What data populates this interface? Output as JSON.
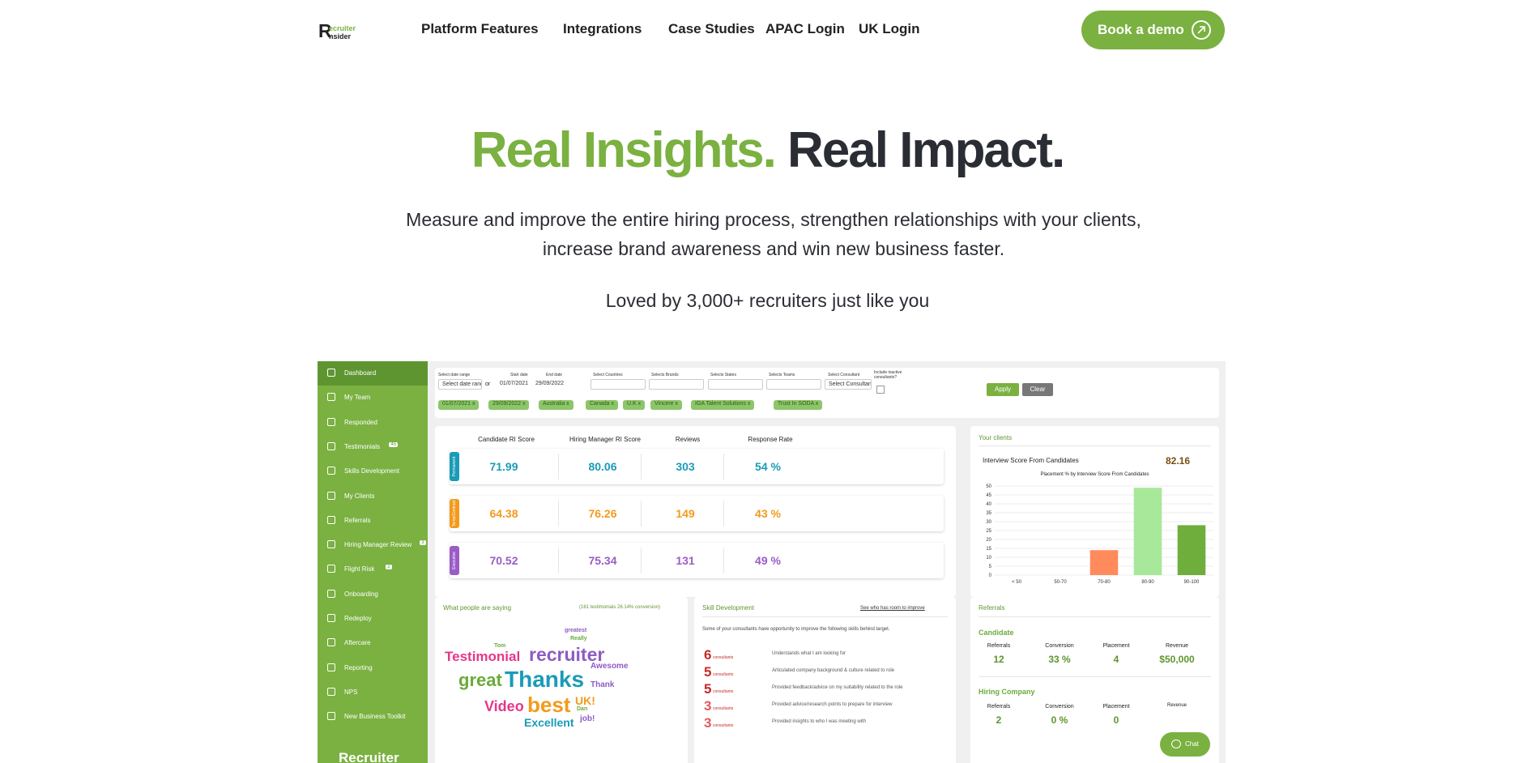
{
  "nav": {
    "logo_top": "ecruiter",
    "logo_bottom": "nsider",
    "links": [
      "Platform Features",
      "Integrations",
      "Case Studies",
      "APAC Login",
      "UK Login"
    ],
    "demo_label": "Book a demo"
  },
  "hero": {
    "title_green": "Real Insights.",
    "title_dark": " Real Impact.",
    "subtitle": "Measure and improve the entire hiring process, strengthen relationships with your clients, increase brand awareness and win new business faster.",
    "loved": "Loved by 3,000+ recruiters just like you"
  },
  "dashboard": {
    "sidebar": [
      {
        "label": "Dashboard",
        "badge": ""
      },
      {
        "label": "My Team",
        "badge": ""
      },
      {
        "label": "Responded",
        "badge": ""
      },
      {
        "label": "Testimonials",
        "badge": "45"
      },
      {
        "label": "Skills Development",
        "badge": ""
      },
      {
        "label": "My Clients",
        "badge": ""
      },
      {
        "label": "Referrals",
        "badge": ""
      },
      {
        "label": "Hiring Manager Review",
        "badge": "3"
      },
      {
        "label": "Flight Risk",
        "badge": "2"
      },
      {
        "label": "Onboarding",
        "badge": ""
      },
      {
        "label": "Redeploy",
        "badge": ""
      },
      {
        "label": "Aftercare",
        "badge": ""
      },
      {
        "label": "Reporting",
        "badge": ""
      },
      {
        "label": "NPS",
        "badge": ""
      },
      {
        "label": "New Business Toolkit",
        "badge": ""
      }
    ],
    "sidebar_logo": "Recruiter",
    "filters": {
      "labels": [
        "Select date range",
        "Start date",
        "End date",
        "Select Countries",
        "Selects Brands",
        "Selects States",
        "Selects Teams",
        "Select Consultant",
        "Include inactive consultants?"
      ],
      "date_range": "Select date range",
      "or": "or",
      "start": "01/07/2021",
      "end": "29/09/2022",
      "consultant": "Select Consultant",
      "chips": [
        "01/07/2021 x",
        "29/09/2022 x",
        "Australia x",
        "Canada x",
        "U.K x",
        "Vincere x",
        "IGA Talent Solutions x",
        "Trust In SODA x"
      ],
      "apply": "Apply",
      "clear": "Clear"
    },
    "scores": {
      "headers": [
        "Candidate RI Score",
        "Hiring Manager RI Score",
        "Reviews",
        "Response Rate"
      ],
      "rows": [
        {
          "tab": "Permanent",
          "color": "#1a9bb8",
          "values": [
            "71.99",
            "80.06",
            "303",
            "54 %"
          ]
        },
        {
          "tab": "Temp/Contract",
          "color": "#f39a1c",
          "values": [
            "64.38",
            "76.26",
            "149",
            "43 %"
          ]
        },
        {
          "tab": "Executive",
          "color": "#9a5cc6",
          "values": [
            "70.52",
            "75.34",
            "131",
            "49 %"
          ]
        }
      ]
    },
    "clients": {
      "title": "Your clients",
      "interview_label": "Interview Score From Candidates",
      "interview_value": "82.16"
    },
    "testimonials": {
      "title": "What people are saying",
      "count": "(161 testimonials 26.14% conversion)",
      "words": [
        {
          "text": "greatest",
          "color": "#8e5bc4"
        },
        {
          "text": "Really",
          "color": "#6aab3a"
        },
        {
          "text": "Tom",
          "color": "#6aab3a"
        },
        {
          "text": "Testimonial",
          "color": "#e5368a"
        },
        {
          "text": "recruiter",
          "color": "#8e5bc4"
        },
        {
          "text": "Awesome",
          "color": "#8e5bc4"
        },
        {
          "text": "great",
          "color": "#6aab3a"
        },
        {
          "text": "Thanks",
          "color": "#1a9bb8"
        },
        {
          "text": "Thank",
          "color": "#8e5bc4"
        },
        {
          "text": "Video",
          "color": "#e5368a"
        },
        {
          "text": "best",
          "color": "#f39a1c"
        },
        {
          "text": "UK!",
          "color": "#f39a1c"
        },
        {
          "text": "Dan",
          "color": "#6aab3a"
        },
        {
          "text": "job!",
          "color": "#8e5bc4"
        },
        {
          "text": "Excellent",
          "color": "#1a9bb8"
        }
      ]
    },
    "skills": {
      "title": "Skill Development",
      "link": "See who has room to improve",
      "intro": "Some of your consultants have opportunity to improve the following skills behind target.",
      "items": [
        {
          "n": "6",
          "unit": "consultants",
          "desc": "Understands what I am looking for",
          "color": "#c52b2b"
        },
        {
          "n": "5",
          "unit": "consultants",
          "desc": "Articulated company background & culture related to role",
          "color": "#c52b2b"
        },
        {
          "n": "5",
          "unit": "consultants",
          "desc": "Provided feedback/advice on my suitability related to the role",
          "color": "#c52b2b"
        },
        {
          "n": "3",
          "unit": "consultants",
          "desc": "Provided advice/research points to prepare for interview",
          "color": "#e05b5b"
        },
        {
          "n": "3",
          "unit": "consultants",
          "desc": "Provided insights to who I was meeting with",
          "color": "#e05b5b"
        }
      ]
    },
    "referrals": {
      "title": "Referrals",
      "headers": [
        "Referrals",
        "Conversion",
        "Placement",
        "Revenue"
      ],
      "sections": [
        {
          "name": "Candidate",
          "values": [
            "12",
            "33 %",
            "4",
            "$50,000"
          ]
        },
        {
          "name": "Hiring Company",
          "values": [
            "2",
            "0 %",
            "0",
            ""
          ]
        }
      ],
      "revenue_short": "Revenue"
    },
    "chat": "Chat"
  },
  "chart_data": {
    "type": "bar",
    "title": "Placement % by Interview Score From Candidates",
    "categories": [
      "< 50",
      "50-70",
      "70-80",
      "80-90",
      "90-100"
    ],
    "values": [
      0,
      0,
      14,
      49,
      28
    ],
    "colors": [
      "#ff8a5c",
      "#ff8a5c",
      "#ff8a5c",
      "#a8e89a",
      "#6fae3d"
    ],
    "ylim": [
      0,
      50
    ],
    "yticks": [
      0,
      5,
      10,
      15,
      20,
      25,
      30,
      35,
      40,
      45,
      50
    ],
    "grid": true
  }
}
